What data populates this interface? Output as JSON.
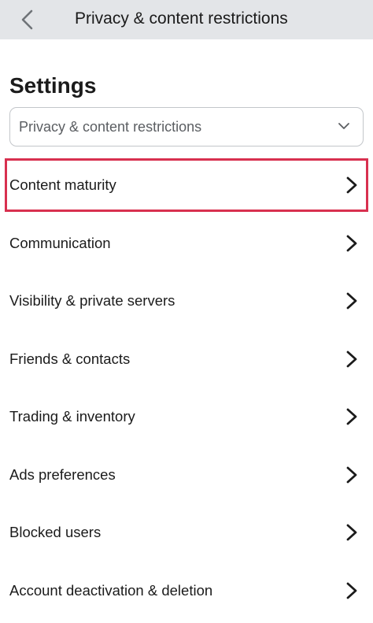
{
  "header": {
    "back_icon": "chevron-left-icon",
    "title": "Privacy & content restrictions"
  },
  "page": {
    "heading": "Settings"
  },
  "category_dropdown": {
    "selected": "Privacy & content restrictions",
    "icon": "chevron-down-icon"
  },
  "menu": {
    "items": [
      {
        "label": "Content maturity",
        "highlighted": true
      },
      {
        "label": "Communication"
      },
      {
        "label": "Visibility & private servers"
      },
      {
        "label": "Friends & contacts"
      },
      {
        "label": "Trading & inventory"
      },
      {
        "label": "Ads preferences"
      },
      {
        "label": "Blocked users"
      },
      {
        "label": "Account deactivation & deletion"
      }
    ],
    "item_icon": "chevron-right-icon"
  },
  "colors": {
    "topbar_bg": "#e3e5e8",
    "highlight_border": "#d8304f",
    "text": "#1b1b1b"
  }
}
